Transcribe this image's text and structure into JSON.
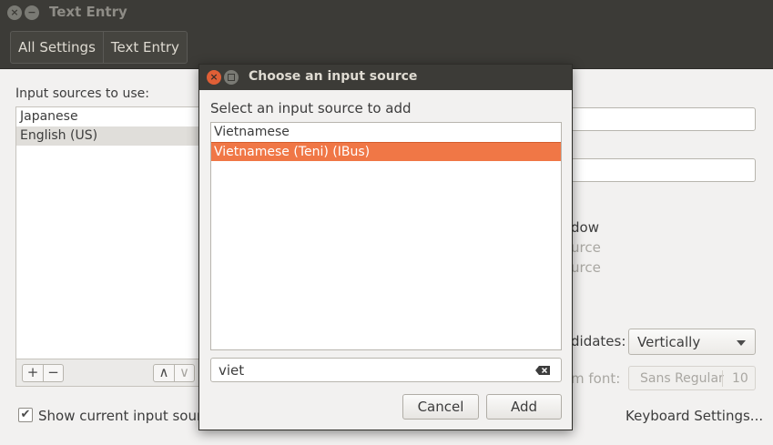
{
  "window": {
    "title": "Text Entry",
    "close_glyph": "×",
    "min_glyph": "−"
  },
  "breadcrumb": {
    "items": [
      "All Settings",
      "Text Entry"
    ]
  },
  "main": {
    "sources_label": "Input sources to use:",
    "sources": [
      {
        "label": "Japanese",
        "selected": false
      },
      {
        "label": "English (US)",
        "selected": true
      }
    ],
    "add_glyph": "+",
    "remove_glyph": "−",
    "up_glyph": "∧",
    "down_glyph": "∨",
    "show_current_label": "Show current input source",
    "show_current_checked": true,
    "partial_labels": {
      "dow": "dow",
      "urce1": "urce",
      "urce2": "urce",
      "didates": "didates:",
      "m_font": "m font:"
    },
    "candidates_value": "Vertically",
    "font_name": "Sans Regular",
    "font_size": "10",
    "keyboard_settings_label": "Keyboard Settings..."
  },
  "dialog": {
    "title": "Choose an input source",
    "subtitle": "Select an input source to add",
    "items": [
      {
        "label": "Vietnamese",
        "selected": false
      },
      {
        "label": "Vietnamese (Teni) (IBus)",
        "selected": true
      }
    ],
    "search_value": "viet",
    "cancel_label": "Cancel",
    "add_label": "Add",
    "close_glyph": "×"
  },
  "colors": {
    "accent": "#f07746",
    "titlebar": "#3c3b37",
    "window_bg": "#f2f1f0"
  }
}
